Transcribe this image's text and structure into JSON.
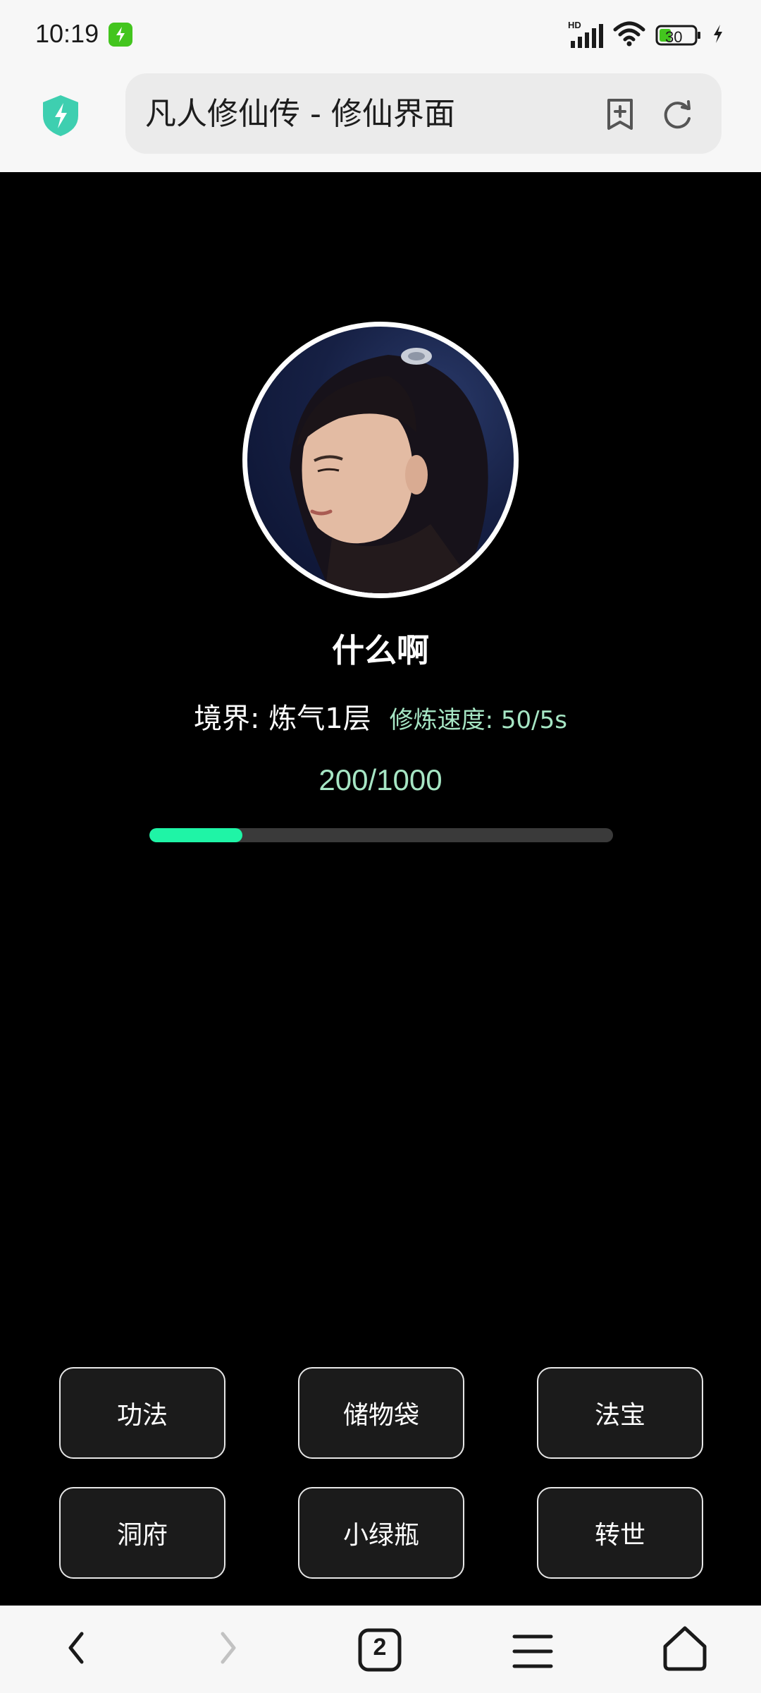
{
  "status_bar": {
    "time": "10:19",
    "battery": "30",
    "network": "HD"
  },
  "browser": {
    "page_title": "凡人修仙传 - 修仙界面",
    "tab_count": "2"
  },
  "player": {
    "name": "什么啊",
    "realm": "境界: 炼气1层",
    "speed": "修炼速度: 50/5s",
    "progress_text": "200/1000",
    "progress_value": 200,
    "progress_max": 1000
  },
  "menu": {
    "gongfa": "功法",
    "chuwudai": "储物袋",
    "fabao": "法宝",
    "dongfu": "洞府",
    "xiaolvping": "小绿瓶",
    "zhuanshi": "转世"
  },
  "colors": {
    "accent": "#1ff4a6",
    "secondary_text": "#a6e6c4",
    "background": "#000000"
  }
}
